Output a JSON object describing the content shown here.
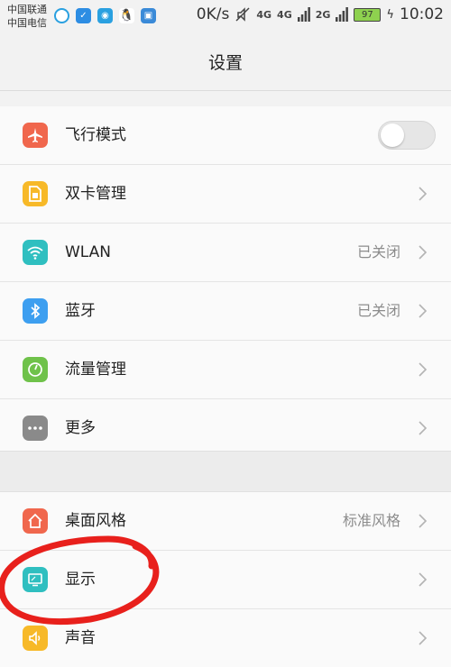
{
  "status_bar": {
    "carrier_1": "中国联通",
    "carrier_2": "中国电信",
    "net_speed": "0K/s",
    "signal_1": "4G",
    "signal_2": "4G",
    "signal_3": "2G",
    "battery": "97",
    "time": "10:02"
  },
  "header": {
    "title": "设置"
  },
  "sections": [
    {
      "items": [
        {
          "label": "飞行模式",
          "icon": "airplane-icon",
          "color": "#f0674d",
          "control": "toggle",
          "toggle_on": false
        },
        {
          "label": "双卡管理",
          "icon": "sim-card-icon",
          "color": "#f7b928",
          "control": "chevron"
        },
        {
          "label": "WLAN",
          "icon": "wifi-icon",
          "color": "#2fbfc0",
          "value": "已关闭",
          "control": "chevron"
        },
        {
          "label": "蓝牙",
          "icon": "bluetooth-icon",
          "color": "#3d9ff0",
          "value": "已关闭",
          "control": "chevron"
        },
        {
          "label": "流量管理",
          "icon": "data-usage-icon",
          "color": "#6fc24a",
          "control": "chevron"
        },
        {
          "label": "更多",
          "icon": "more-dots-icon",
          "color": "#8a8a8a",
          "control": "chevron"
        }
      ]
    },
    {
      "items": [
        {
          "label": "桌面风格",
          "icon": "home-icon",
          "color": "#f0674d",
          "value": "标准风格",
          "control": "chevron"
        },
        {
          "label": "显示",
          "icon": "display-icon",
          "color": "#2fbfc0",
          "control": "chevron"
        },
        {
          "label": "声音",
          "icon": "speaker-icon",
          "color": "#f7b928",
          "control": "chevron"
        }
      ]
    }
  ],
  "annotation_color": "#e8201c"
}
